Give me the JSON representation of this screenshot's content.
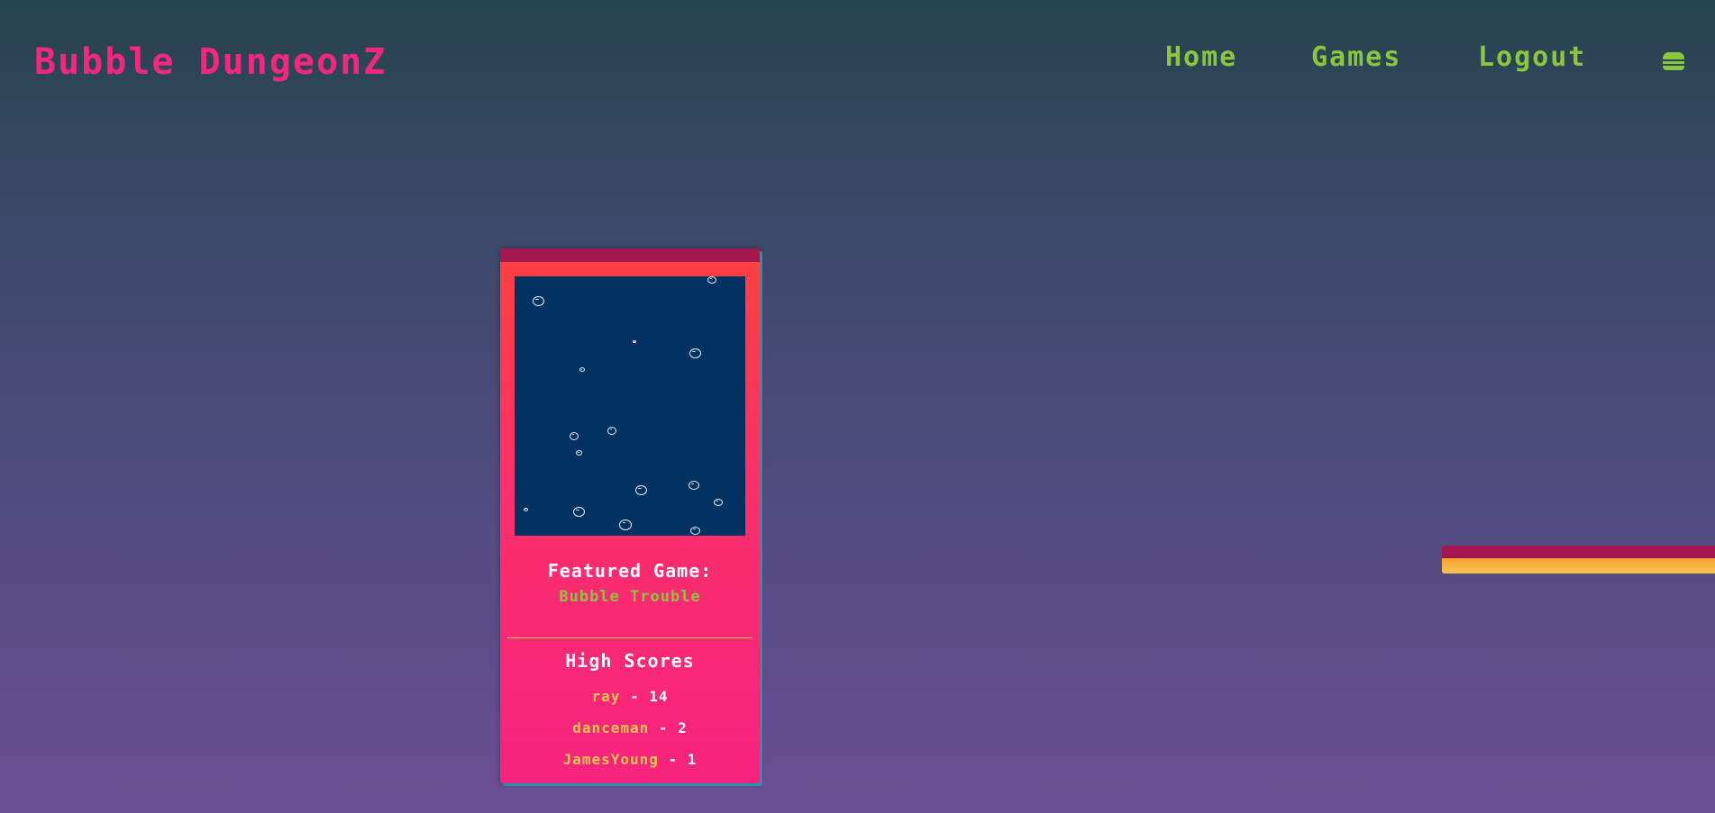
{
  "header": {
    "brand": "Bubble DungeonZ",
    "nav": {
      "home": "Home",
      "games": "Games",
      "logout": "Logout",
      "menu_icon": "hamburger-icon"
    }
  },
  "featured": {
    "label": "Featured Game:",
    "game_title": "Bubble Trouble"
  },
  "high_scores": {
    "title": "High Scores",
    "separator": "-",
    "entries": [
      {
        "name": "ray",
        "score": "14"
      },
      {
        "name": "danceman",
        "score": "2"
      },
      {
        "name": "JamesYoung",
        "score": "1"
      }
    ]
  },
  "colors": {
    "brand": "#f5267e",
    "nav": "#8cc63f",
    "card": "#fb2f6a",
    "game_canvas": "#023262",
    "score_name": "#f2c94c"
  }
}
